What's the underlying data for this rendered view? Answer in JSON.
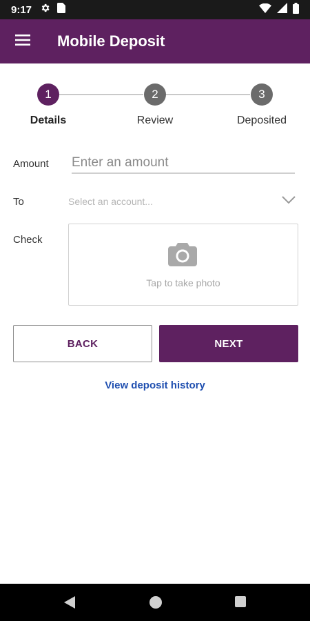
{
  "status_bar": {
    "time": "9:17",
    "left_icons": [
      "gear-icon",
      "sim-card-icon"
    ],
    "right_icons": [
      "wifi-icon",
      "signal-icon",
      "battery-icon"
    ]
  },
  "app_bar": {
    "title": "Mobile Deposit",
    "menu_icon": "hamburger-menu-icon"
  },
  "stepper": {
    "steps": [
      {
        "number": "1",
        "label": "Details",
        "active": true
      },
      {
        "number": "2",
        "label": "Review",
        "active": false
      },
      {
        "number": "3",
        "label": "Deposited",
        "active": false
      }
    ]
  },
  "form": {
    "amount_label": "Amount",
    "amount_placeholder": "Enter an amount",
    "amount_value": "",
    "to_label": "To",
    "to_placeholder": "Select an account...",
    "check_label": "Check",
    "photo_prompt": "Tap to take photo",
    "photo_icon": "camera-icon"
  },
  "actions": {
    "back_label": "BACK",
    "next_label": "NEXT",
    "history_link": "View deposit history"
  },
  "nav_bar": {
    "buttons": [
      "back-triangle-icon",
      "home-circle-icon",
      "recents-square-icon"
    ]
  },
  "colors": {
    "brand": "#5e2160",
    "link": "#1f4fb0",
    "step_inactive": "#6b6b6b"
  }
}
